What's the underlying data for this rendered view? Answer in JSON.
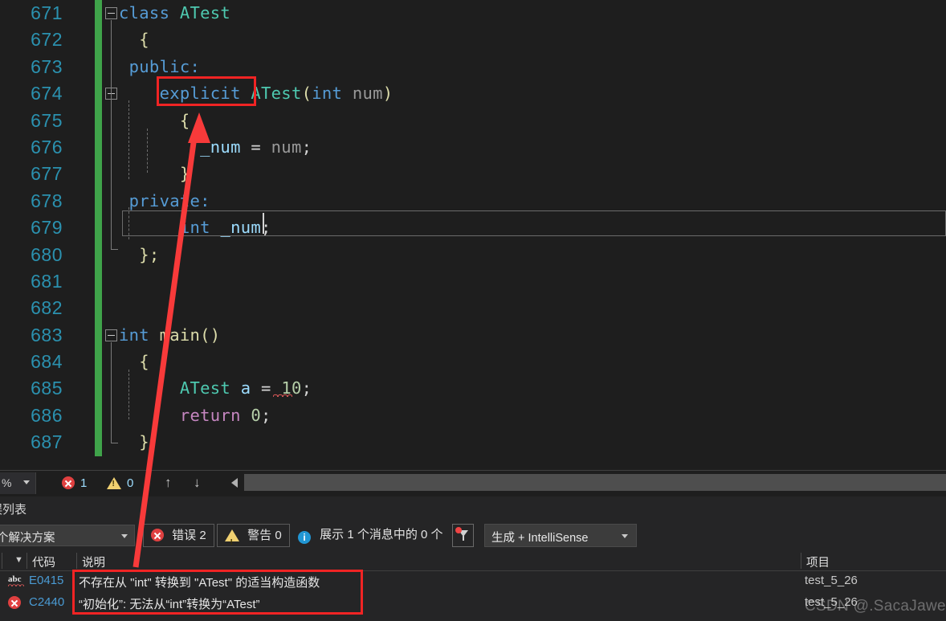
{
  "editor": {
    "first_line_number": 671,
    "lines": [
      {
        "num": "671",
        "changed": true,
        "tokens": [
          {
            "t": "class ",
            "c": "k"
          },
          {
            "t": "ATest",
            "c": "t"
          }
        ]
      },
      {
        "num": "672",
        "changed": true,
        "tokens": [
          {
            "t": "  {",
            "c": "pl"
          }
        ]
      },
      {
        "num": "673",
        "changed": true,
        "tokens": [
          {
            "t": " public:",
            "c": "k"
          }
        ]
      },
      {
        "num": "674",
        "changed": true,
        "tokens": [
          {
            "t": "    ",
            "c": "br"
          },
          {
            "t": "explicit",
            "c": "k"
          },
          {
            "t": " ",
            "c": "br"
          },
          {
            "t": "ATest",
            "c": "t"
          },
          {
            "t": "(",
            "c": "pl"
          },
          {
            "t": "int",
            "c": "k"
          },
          {
            "t": " ",
            "c": "br"
          },
          {
            "t": "num",
            "c": "gray"
          },
          {
            "t": ")",
            "c": "pl"
          }
        ]
      },
      {
        "num": "675",
        "changed": true,
        "tokens": [
          {
            "t": "      {",
            "c": "pl"
          }
        ]
      },
      {
        "num": "676",
        "changed": true,
        "tokens": [
          {
            "t": "        ",
            "c": "br"
          },
          {
            "t": "_num",
            "c": "v"
          },
          {
            "t": " = ",
            "c": "br"
          },
          {
            "t": "num",
            "c": "gray"
          },
          {
            "t": ";",
            "c": "br"
          }
        ]
      },
      {
        "num": "677",
        "changed": true,
        "tokens": [
          {
            "t": "      }",
            "c": "pl"
          }
        ]
      },
      {
        "num": "678",
        "changed": true,
        "tokens": [
          {
            "t": " private:",
            "c": "k"
          }
        ]
      },
      {
        "num": "679",
        "changed": true,
        "tokens": [
          {
            "t": "      ",
            "c": "br"
          },
          {
            "t": "int",
            "c": "k"
          },
          {
            "t": " ",
            "c": "br"
          },
          {
            "t": "_num",
            "c": "v"
          },
          {
            "t": ";",
            "c": "br"
          }
        ]
      },
      {
        "num": "680",
        "changed": true,
        "tokens": [
          {
            "t": "  };",
            "c": "pl"
          }
        ]
      },
      {
        "num": "681",
        "changed": true,
        "tokens": []
      },
      {
        "num": "682",
        "changed": true,
        "tokens": []
      },
      {
        "num": "683",
        "changed": true,
        "tokens": [
          {
            "t": "int ",
            "c": "k"
          },
          {
            "t": "main",
            "c": "fn"
          },
          {
            "t": "()",
            "c": "pl"
          }
        ]
      },
      {
        "num": "684",
        "changed": true,
        "tokens": [
          {
            "t": "  {",
            "c": "pl"
          }
        ]
      },
      {
        "num": "685",
        "changed": true,
        "tokens": [
          {
            "t": "      ",
            "c": "br"
          },
          {
            "t": "ATest",
            "c": "t"
          },
          {
            "t": " ",
            "c": "br"
          },
          {
            "t": "a",
            "c": "v"
          },
          {
            "t": " = ",
            "c": "br"
          },
          {
            "t": "10",
            "c": "n"
          },
          {
            "t": ";",
            "c": "br"
          }
        ]
      },
      {
        "num": "686",
        "changed": true,
        "tokens": [
          {
            "t": "      ",
            "c": "br"
          },
          {
            "t": "return",
            "c": "p"
          },
          {
            "t": " ",
            "c": "br"
          },
          {
            "t": "0",
            "c": "n"
          },
          {
            "t": ";",
            "c": "br"
          }
        ]
      },
      {
        "num": "687",
        "changed": true,
        "tokens": [
          {
            "t": "  }",
            "c": "pl"
          }
        ]
      }
    ]
  },
  "statusbar": {
    "zoom_label": "%",
    "error_count": "1",
    "warning_count": "0",
    "nav_up_icon": "↑",
    "nav_down_icon": "↓"
  },
  "panel": {
    "tab_label": "误列表",
    "scope_value": "个解决方案",
    "errors_toggle": "错误 2",
    "warnings_toggle": "警告 0",
    "messages_toggle": "展示 1 个消息中的 0 个",
    "build_filter_value": "生成 + IntelliSense",
    "columns": {
      "sort_icon": "▼",
      "code": "代码",
      "description": "说明",
      "project": "项目"
    },
    "rows": [
      {
        "icon": "abc-squiggle-icon",
        "code": "E0415",
        "description": "不存在从 \"int\" 转换到 \"ATest\" 的适当构造函数",
        "project": "test_5_26"
      },
      {
        "icon": "error-x-icon",
        "code": "C2440",
        "description": "“初始化”: 无法从“int”转换为“ATest”",
        "project": "test_5_26"
      }
    ]
  },
  "annotations": {
    "highlight_box_1_target": "explicit",
    "highlight_box_2_target": "error-rows",
    "arrow_color": "#f83a3a",
    "box_color": "#f02424",
    "watermark": "CSDN @.SacaJawea"
  }
}
